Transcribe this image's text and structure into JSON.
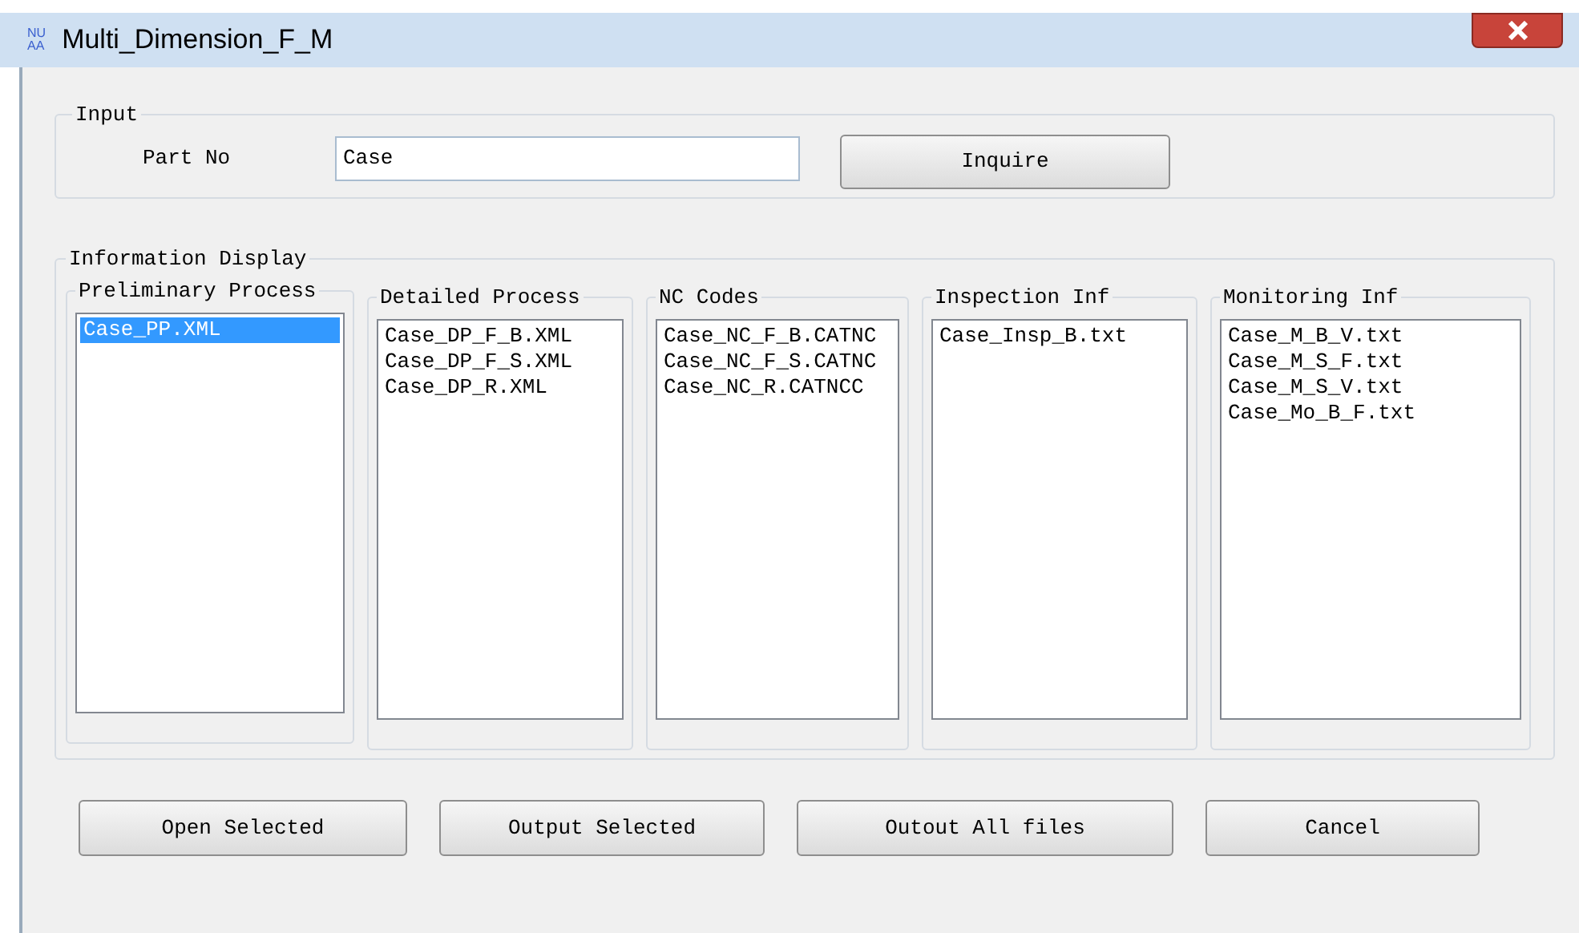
{
  "window": {
    "logo_text": [
      "NU",
      "AA"
    ],
    "title": "Multi_Dimension_F_M"
  },
  "input": {
    "title": "Input",
    "label": "Part No",
    "value": "Case",
    "button": "Inquire"
  },
  "display": {
    "title": "Information Display",
    "lists": [
      {
        "title": "Preliminary Process",
        "items": [
          {
            "text": "Case_PP.XML",
            "selected": true
          }
        ]
      },
      {
        "title": "Detailed Process",
        "items": [
          {
            "text": "Case_DP_F_B.XML",
            "selected": false
          },
          {
            "text": "Case_DP_F_S.XML",
            "selected": false
          },
          {
            "text": "Case_DP_R.XML",
            "selected": false
          }
        ]
      },
      {
        "title": "NC Codes",
        "items": [
          {
            "text": "Case_NC_F_B.CATNC",
            "selected": false
          },
          {
            "text": "Case_NC_F_S.CATNC",
            "selected": false
          },
          {
            "text": "Case_NC_R.CATNCC",
            "selected": false
          }
        ]
      },
      {
        "title": "Inspection Inf",
        "items": [
          {
            "text": "Case_Insp_B.txt",
            "selected": false
          }
        ]
      },
      {
        "title": "Monitoring Inf",
        "items": [
          {
            "text": "Case_M_B_V.txt",
            "selected": false
          },
          {
            "text": "Case_M_S_F.txt",
            "selected": false
          },
          {
            "text": "Case_M_S_V.txt",
            "selected": false
          },
          {
            "text": "Case_Mo_B_F.txt",
            "selected": false
          }
        ]
      }
    ]
  },
  "buttons": [
    "Open Selected",
    "Output Selected",
    "Outout All files",
    "Cancel"
  ]
}
